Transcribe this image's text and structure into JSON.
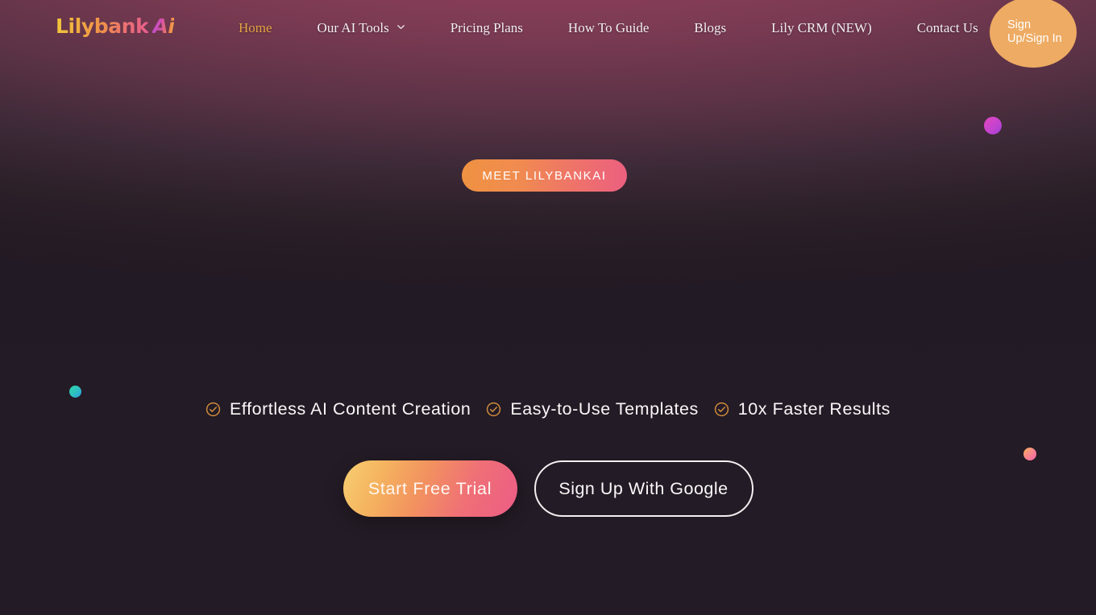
{
  "brand": {
    "word": "Lilybank",
    "mark": "Ai",
    "logo_colors": {
      "word_start": "#f2c83c",
      "word_end": "#e85d8e",
      "mark_start": "#b44fd0",
      "mark_end": "#f4b63c"
    }
  },
  "nav": {
    "items": [
      {
        "label": "Home",
        "active": true,
        "has_dropdown": false
      },
      {
        "label": "Our AI Tools",
        "active": false,
        "has_dropdown": true
      },
      {
        "label": "Pricing Plans",
        "active": false,
        "has_dropdown": false
      },
      {
        "label": "How To Guide",
        "active": false,
        "has_dropdown": false
      },
      {
        "label": "Blogs",
        "active": false,
        "has_dropdown": false
      },
      {
        "label": "Lily CRM (NEW)",
        "active": false,
        "has_dropdown": false
      },
      {
        "label": "Contact Us",
        "active": false,
        "has_dropdown": false
      }
    ],
    "active_color": "#e4a443",
    "text_color": "#f2eef0"
  },
  "signup": {
    "label": "Sign Up/Sign In",
    "background": "#eeab63",
    "text_color": "#ffffff"
  },
  "hero": {
    "meet_button": {
      "label": "MEET LILYBANKAI",
      "gradient_start": "#ef9242",
      "gradient_end": "#ec6080"
    },
    "features": [
      {
        "icon": "check-circle-icon",
        "label": "Effortless AI Content Creation"
      },
      {
        "icon": "check-circle-icon",
        "label": "Easy-to-Use Templates"
      },
      {
        "icon": "check-circle-icon",
        "label": "10x Faster Results"
      }
    ],
    "feature_icon_color": "#d08b3e",
    "cta": {
      "primary_label": "Start Free Trial",
      "secondary_label": "Sign Up With Google",
      "primary_gradient_start": "#f7cf71",
      "primary_gradient_end": "#ed5c86",
      "secondary_border": "#f3eff1"
    }
  },
  "decor": {
    "dots": [
      {
        "name": "purple-dot",
        "color_start": "#e248bd",
        "color_end": "#9b3fd6"
      },
      {
        "name": "teal-dot",
        "color_start": "#2fd3a5",
        "color_end": "#2f9fe0"
      },
      {
        "name": "pink-dot",
        "color_start": "#f7b255",
        "color_end": "#f562a6"
      }
    ]
  },
  "theme": {
    "background_dark": "#231b25",
    "background_glow": "#9c4462"
  }
}
